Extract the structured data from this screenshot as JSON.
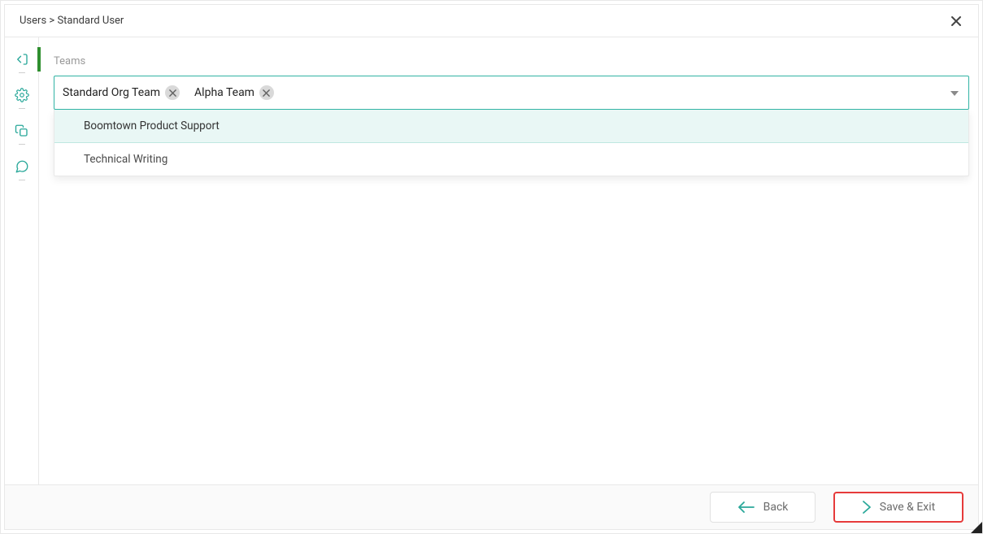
{
  "breadcrumb": {
    "root": "Users",
    "separator": ">",
    "current": "Standard User"
  },
  "teams": {
    "label": "Teams",
    "selected": [
      {
        "name": "Standard Org Team"
      },
      {
        "name": "Alpha Team"
      }
    ],
    "options": [
      {
        "name": "Boomtown Product Support",
        "highlight": true
      },
      {
        "name": "Technical Writing",
        "highlight": false
      }
    ]
  },
  "footer": {
    "back_label": "Back",
    "save_label": "Save & Exit"
  }
}
